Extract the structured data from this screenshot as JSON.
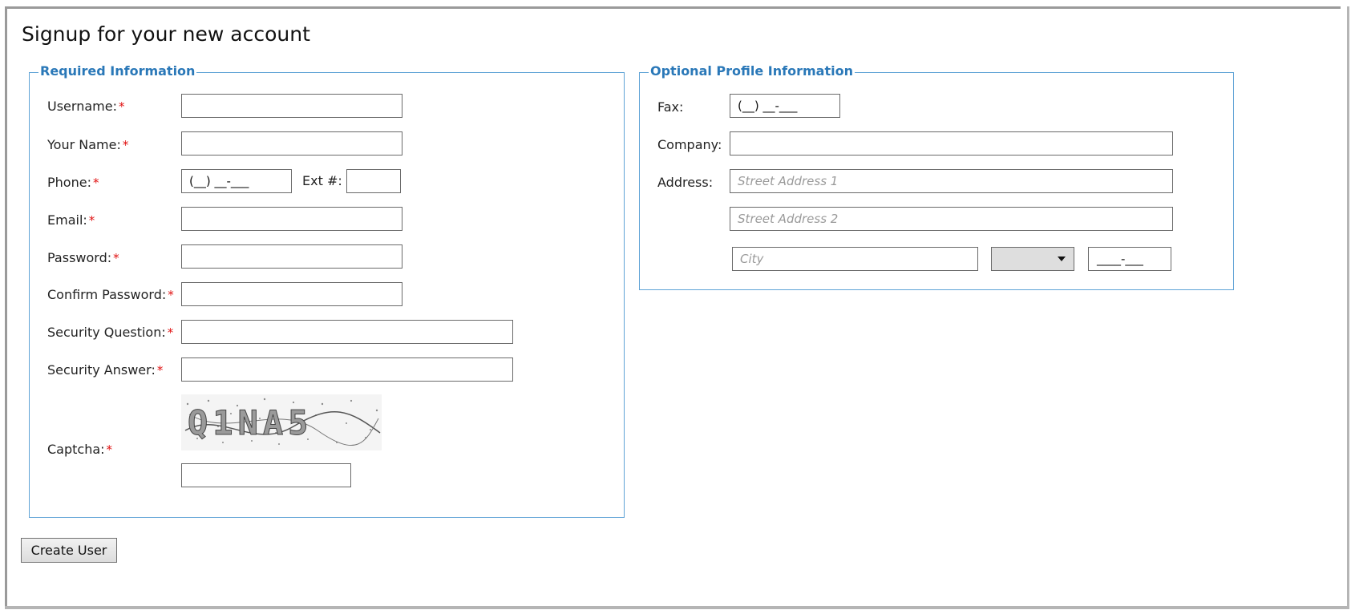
{
  "page": {
    "title": "Signup for your new account"
  },
  "required_section": {
    "legend": "Required Information",
    "required_marker": "*",
    "fields": {
      "username": {
        "label": "Username:"
      },
      "your_name": {
        "label": "Your Name:"
      },
      "phone": {
        "label": "Phone:",
        "mask": "(__) __-___"
      },
      "ext": {
        "label": "Ext #:"
      },
      "email": {
        "label": "Email:"
      },
      "password": {
        "label": "Password:"
      },
      "confirm_password": {
        "label": "Confirm Password:"
      },
      "security_question": {
        "label": "Security Question:"
      },
      "security_answer": {
        "label": "Security Answer:"
      },
      "captcha": {
        "label": "Captcha:",
        "image_text": "Q1NA5"
      }
    }
  },
  "optional_section": {
    "legend": "Optional Profile Information",
    "fields": {
      "fax": {
        "label": "Fax:",
        "mask": "(__) __-___"
      },
      "company": {
        "label": "Company:"
      },
      "address": {
        "label": "Address:"
      },
      "street1": {
        "placeholder": "Street Address 1"
      },
      "street2": {
        "placeholder": "Street Address 2"
      },
      "city": {
        "placeholder": "City"
      },
      "state": {
        "selected": ""
      },
      "zip": {
        "mask": "____-___"
      }
    }
  },
  "actions": {
    "create_user": "Create User"
  },
  "colors": {
    "accent": "#2a78b8",
    "border_accent": "#5fa3d6",
    "required": "#e01010"
  }
}
